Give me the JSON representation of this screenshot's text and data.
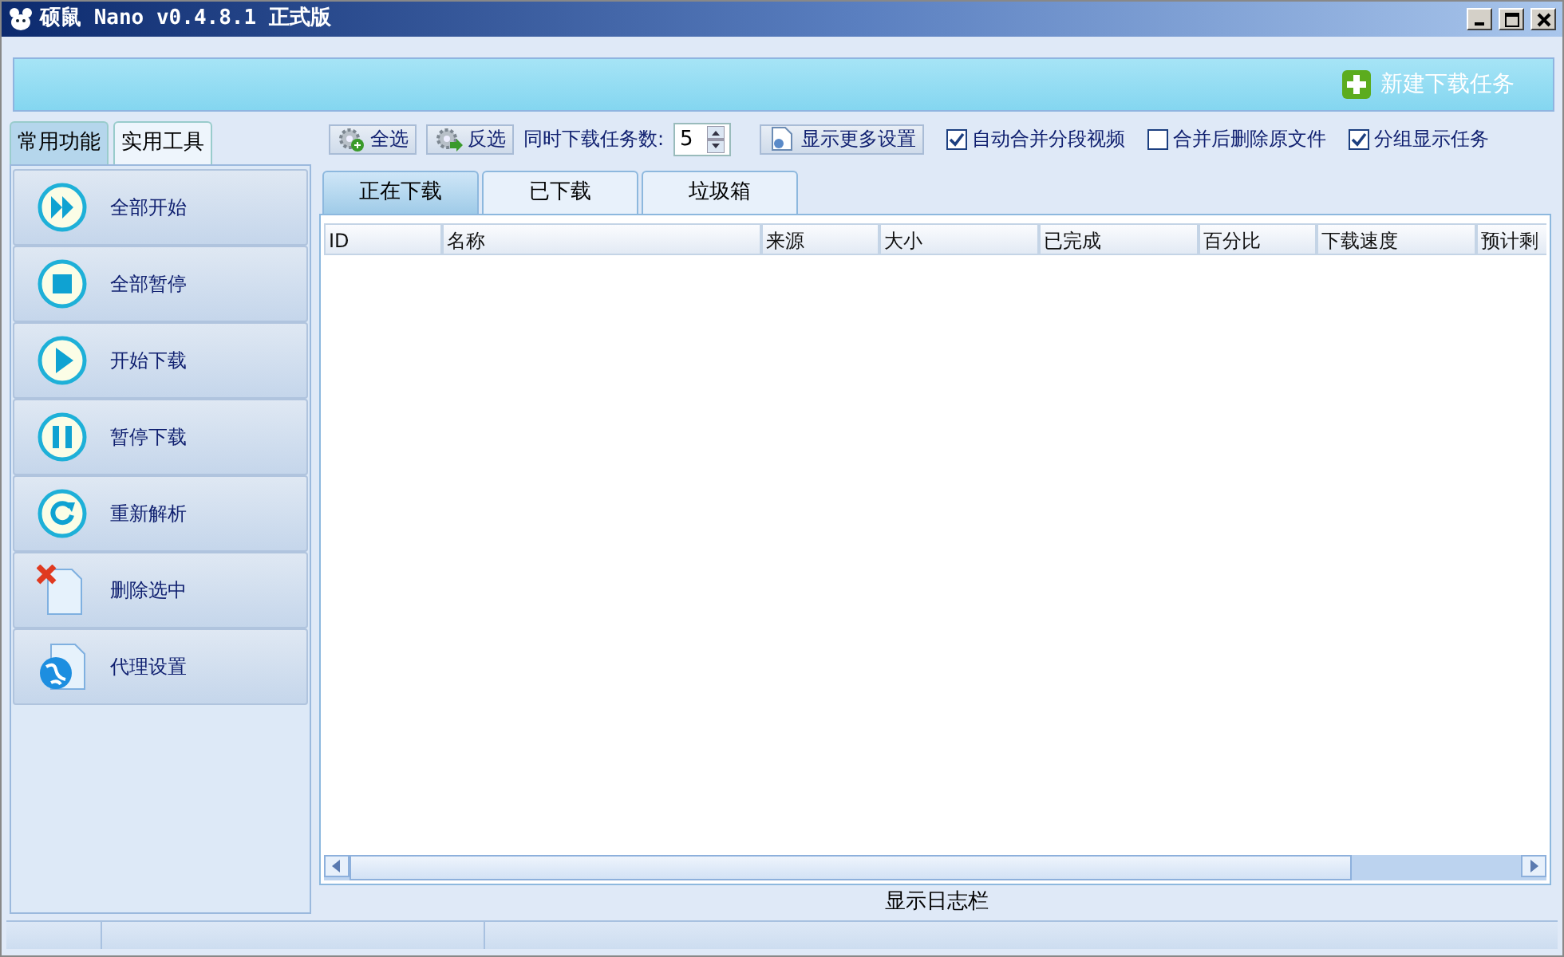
{
  "window": {
    "title": "硕鼠 Nano v0.4.8.1 正式版"
  },
  "banner": {
    "new_task": "新建下载任务"
  },
  "side_tabs": [
    {
      "label": "常用功能",
      "selected": true
    },
    {
      "label": "实用工具",
      "selected": false
    }
  ],
  "side_actions": [
    {
      "label": "全部开始",
      "kind": "fast-forward"
    },
    {
      "label": "全部暂停",
      "kind": "stop"
    },
    {
      "label": "开始下载",
      "kind": "play"
    },
    {
      "label": "暂停下载",
      "kind": "pause"
    },
    {
      "label": "重新解析",
      "kind": "refresh"
    },
    {
      "label": "删除选中",
      "kind": "delete"
    },
    {
      "label": "代理设置",
      "kind": "globe"
    }
  ],
  "toolbar": {
    "select_all": "全选",
    "invert": "反选",
    "concurrent_label": "同时下载任务数:",
    "concurrent_value": "5",
    "more_settings": "显示更多设置",
    "options": [
      {
        "label": "自动合并分段视频",
        "checked": true
      },
      {
        "label": "合并后删除原文件",
        "checked": false
      },
      {
        "label": "分组显示任务",
        "checked": true
      }
    ]
  },
  "tabs": [
    {
      "label": "正在下载",
      "selected": true
    },
    {
      "label": "已下载",
      "selected": false
    },
    {
      "label": "垃圾箱",
      "selected": false
    }
  ],
  "table": {
    "columns": [
      "ID",
      "名称",
      "来源",
      "大小",
      "已完成",
      "百分比",
      "下载速度",
      "预计剩"
    ]
  },
  "log_toggle": "显示日志栏"
}
